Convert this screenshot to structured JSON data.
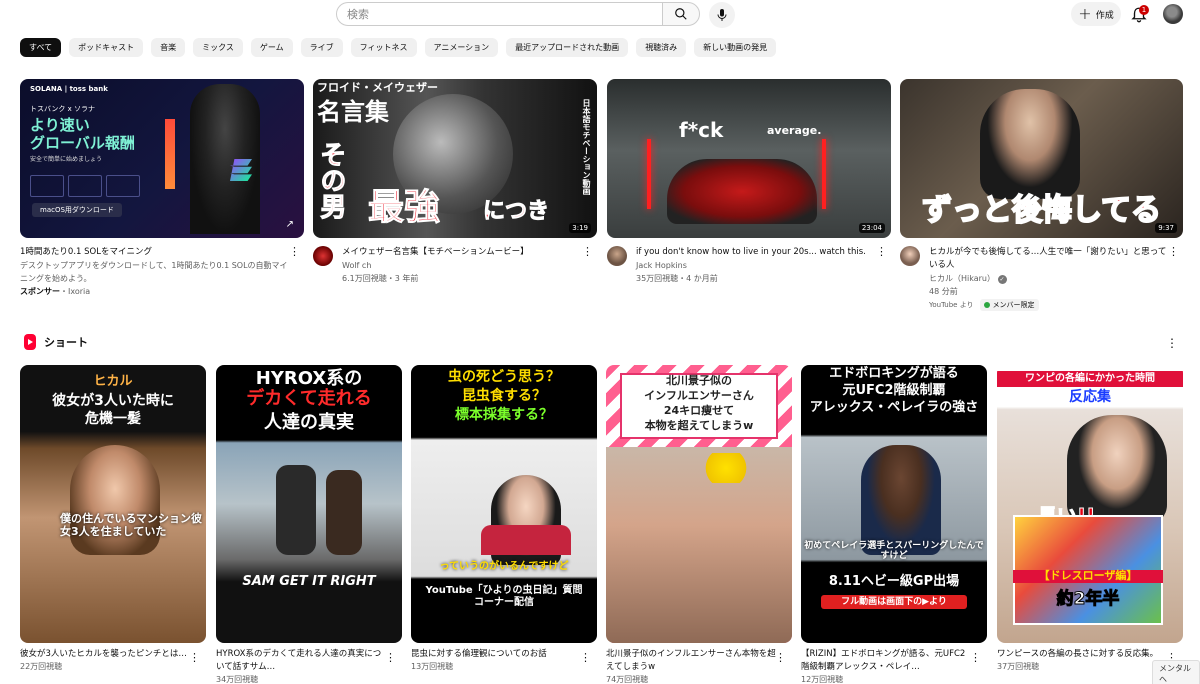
{
  "search": {
    "placeholder": "検索"
  },
  "header": {
    "create_label": "作成",
    "notification_count": "1"
  },
  "chips": [
    "すべて",
    "ポッドキャスト",
    "音楽",
    "ミックス",
    "ゲーム",
    "ライブ",
    "フィットネス",
    "アニメーション",
    "最近アップロードされた動画",
    "視聴済み",
    "新しい動画の発見"
  ],
  "videos": [
    {
      "title": "1時間あたり0.1 SOLをマイニング",
      "description": "デスクトップアプリをダウンロードして、1時間あたり0.1 SOLの自動マイニングを始めよう。",
      "sponsor_label": "スポンサー",
      "sponsor_name": "・Ixoria",
      "thumb": {
        "brand": "SOLANA | toss bank",
        "line1": "トスバンク x ソラナ",
        "line2": "より速い",
        "line3": "グローバル報酬",
        "line4": "安全で簡単に始めましょう",
        "button": "macOS用ダウンロード"
      }
    },
    {
      "title": "メイウェザー名言集【モチベーションムービー】",
      "channel": "Wolf ch",
      "meta": "6.1万回視聴・3 年前",
      "duration": "3:19",
      "thumb": {
        "top": "フロイド・メイウェザー",
        "big": "名言集",
        "side": "日本語モチベーション動画",
        "bottom1": "その男",
        "bottom2": "最強",
        "bottom3": "につき"
      }
    },
    {
      "title": "if you don't know how to live in your 20s... watch this.",
      "channel": "Jack Hopkins",
      "meta": "35万回視聴・4 か月前",
      "duration": "23:04",
      "thumb": {
        "text1": "f*ck",
        "text2": "average."
      }
    },
    {
      "title": "ヒカルが今でも後悔してる…人生で唯一「謝りたい」と思っている人",
      "channel": "ヒカル（Hikaru）",
      "meta": "48 分前",
      "source": "YouTube より",
      "member": "メンバー限定",
      "duration": "9:37",
      "thumb": {
        "caption": "ずっと後悔してる"
      }
    }
  ],
  "shorts_section": {
    "title": "ショート"
  },
  "shorts": [
    {
      "title": "彼女が3人いたヒカルを襲ったピンチとは…",
      "views": "22万回視聴",
      "top1": "ヒカル",
      "top2": "彼女が3人いた時に",
      "top3": "危機一髪",
      "bottom": "僕の住んでいるマンション彼女3人を住ましていた"
    },
    {
      "title": "HYROX系のデカくて走れる人達の真実について話すサム…",
      "views": "34万回視聴",
      "top1": "HYROX系の",
      "top2": "デカくて走れる",
      "top3": "人達の真実",
      "bottom": "SAM GET IT RIGHT"
    },
    {
      "title": "昆虫に対する倫理観についてのお話",
      "views": "13万回視聴",
      "top1": "虫の死どう思う？",
      "top2": "昆虫食する？",
      "top3": "標本採集する？",
      "mid": "っていうのがいるんですけど",
      "bottom": "YouTube「ひよりの虫日記」質問コーナー配信"
    },
    {
      "title": "北川景子似のインフルエンサーさん本物を超えてしまうw",
      "views": "74万回視聴",
      "top1": "北川景子似の",
      "top2": "インフルエンサーさん",
      "top3": "24キロ痩せて",
      "top4": "本物を超えてしまうw"
    },
    {
      "title": "【RIZIN】エドボロキングが語る、元UFC2階級制覇アレックス・ペレイ…",
      "views": "12万回視聴",
      "top1": "エドボロキングが語る",
      "top2": "元UFC2階級制覇",
      "top3": "アレックス・ペレイラの強さ",
      "mid": "初めてペレイラ選手とスパーリングしたんですけど",
      "bottom1": "8.11ヘビー級GP出場",
      "bottom2": "フル動画は画面下の▶より"
    },
    {
      "title": "ワンピースの各編の長さに対する反応集。",
      "views": "37万回視聴",
      "top1": "ワンピの各編にかかった時間",
      "top2": "反応集",
      "mid": "長い!!",
      "bottom1": "【ドレスローザ編】",
      "bottom2": "約2年半"
    }
  ],
  "tooltip": "メンタルヘ"
}
